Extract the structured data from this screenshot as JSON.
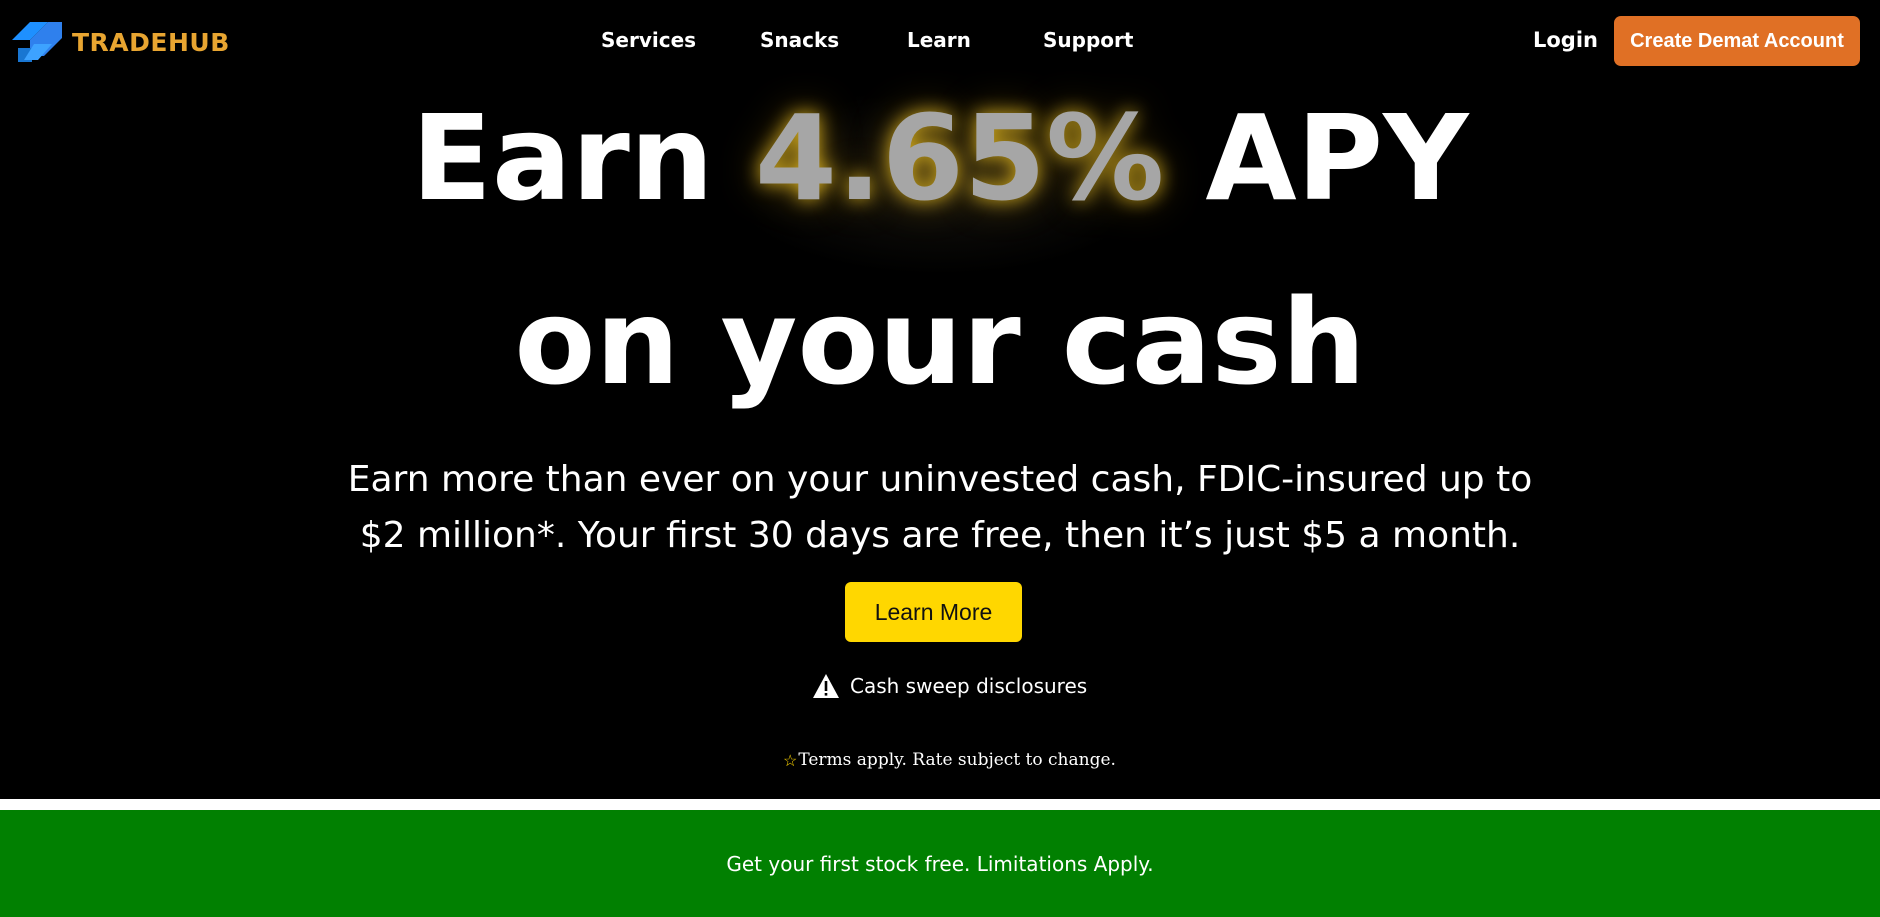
{
  "brand": {
    "name": "TRADEHUB",
    "logo_icon": "arrow-logo-icon",
    "color": "#e8a531"
  },
  "nav": {
    "items": [
      {
        "label": "Services"
      },
      {
        "label": "Snacks"
      },
      {
        "label": "Learn"
      },
      {
        "label": "Support"
      }
    ],
    "login_label": "Login",
    "cta_label": "Create Demat Account",
    "cta_color": "#e07025"
  },
  "hero": {
    "headline_prefix": "Earn ",
    "headline_rate": "4.65%",
    "headline_suffix": " APY",
    "headline_line2": "on your cash",
    "subtitle_line1": "Earn more than ever on your uninvested cash, FDIC-insured up to",
    "subtitle_line2": "$2 million*. Your first 30 days are free, then it’s just $5 a month.",
    "button_label": "Learn More",
    "button_color": "#ffd700",
    "disclosure_icon": "warning-icon",
    "disclosure_label": "Cash sweep disclosures",
    "terms_icon": "star-icon",
    "terms_text": "Terms apply. Rate subject to change."
  },
  "promo": {
    "text": "Get your first stock free. Limitations Apply.",
    "color": "#018001"
  }
}
